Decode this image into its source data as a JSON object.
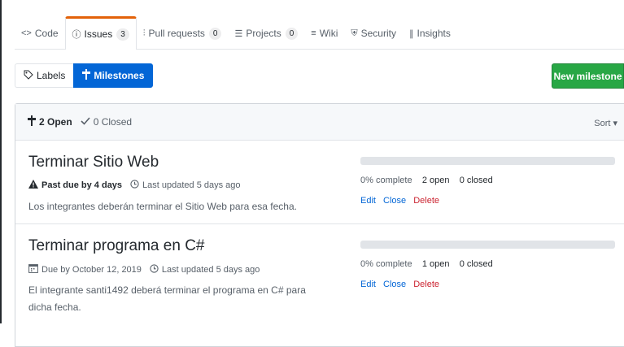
{
  "tabs": [
    {
      "label": "Code",
      "icon": "code-icon",
      "glyph": "<>"
    },
    {
      "label": "Issues",
      "icon": "issue-icon",
      "glyph": "ⓘ",
      "count": "3"
    },
    {
      "label": "Pull requests",
      "icon": "pull-request-icon",
      "glyph": "⫶",
      "count": "0"
    },
    {
      "label": "Projects",
      "icon": "project-icon",
      "glyph": "☰",
      "count": "0"
    },
    {
      "label": "Wiki",
      "icon": "book-icon",
      "glyph": "≡"
    },
    {
      "label": "Security",
      "icon": "shield-icon",
      "glyph": "⛨"
    },
    {
      "label": "Insights",
      "icon": "graph-icon",
      "glyph": "∥"
    }
  ],
  "subnav": {
    "labels": "Labels",
    "milestones": "Milestones"
  },
  "new_milestone": "New milestone",
  "states": {
    "open": "2 Open",
    "closed": "0 Closed"
  },
  "sort": "Sort ▾",
  "milestones": [
    {
      "title": "Terminar Sitio Web",
      "due": "Past due by 4 days",
      "updated": "Last updated 5 days ago",
      "description": "Los integrantes deberán terminar el Sitio Web para esa fecha.",
      "progress": 0,
      "complete": "0% complete",
      "open": "2 open",
      "closed": "0 closed",
      "actions": {
        "edit": "Edit",
        "close": "Close",
        "delete": "Delete"
      }
    },
    {
      "title": "Terminar programa en C#",
      "due": "Due by October 12, 2019",
      "updated": "Last updated 5 days ago",
      "description": "El integrante santi1492 deberá terminar el programa en C# para dicha fecha.",
      "progress": 0,
      "complete": "0% complete",
      "open": "1 open",
      "closed": "0 closed",
      "actions": {
        "edit": "Edit",
        "close": "Close",
        "delete": "Delete"
      }
    }
  ],
  "colors": {
    "accent": "#e36209",
    "primary": "#0366d6",
    "success": "#28a745",
    "danger": "#cb2431"
  }
}
